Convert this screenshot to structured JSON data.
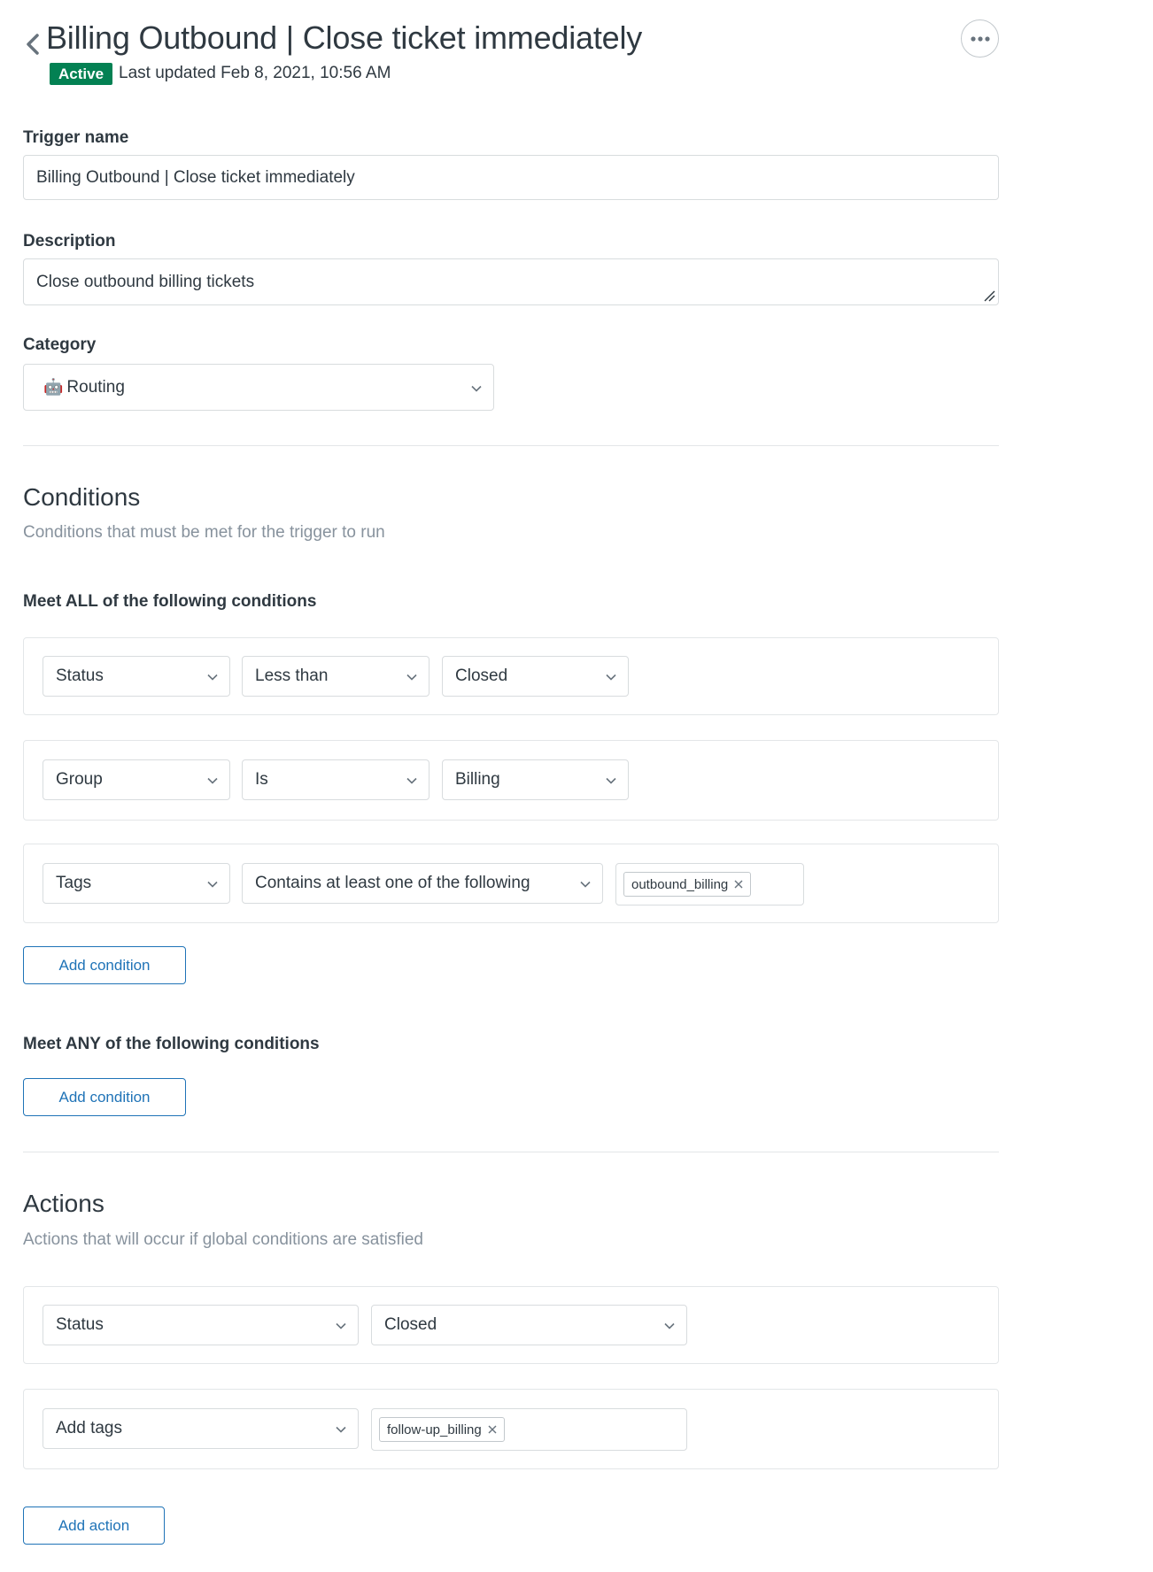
{
  "header": {
    "title": "Billing Outbound | Close ticket immediately",
    "status": "Active",
    "last_updated": "Last updated Feb 8, 2021, 10:56 AM"
  },
  "form": {
    "trigger_name": {
      "label": "Trigger name",
      "value": "Billing Outbound | Close ticket immediately"
    },
    "description": {
      "label": "Description",
      "value": "Close outbound billing tickets"
    },
    "category": {
      "label": "Category",
      "emoji": "🤖",
      "value": "Routing"
    }
  },
  "conditions": {
    "title": "Conditions",
    "description": "Conditions that must be met for the trigger to run",
    "all": {
      "label": "Meet ALL of the following conditions",
      "rows": [
        {
          "field": "Status",
          "operator": "Less than",
          "value": "Closed"
        },
        {
          "field": "Group",
          "operator": "Is",
          "value": "Billing"
        },
        {
          "field": "Tags",
          "operator": "Contains at least one of the following",
          "tag": "outbound_billing"
        }
      ],
      "add_label": "Add condition"
    },
    "any": {
      "label": "Meet ANY of the following conditions",
      "add_label": "Add condition"
    }
  },
  "actions": {
    "title": "Actions",
    "description": "Actions that will occur if global conditions are satisfied",
    "rows": [
      {
        "field": "Status",
        "value": "Closed"
      },
      {
        "field": "Add tags",
        "tag": "follow-up_billing"
      }
    ],
    "add_label": "Add action"
  },
  "colors": {
    "active_badge": "#038153",
    "primary": "#1f73b7",
    "text": "#2f3941",
    "muted": "#87929d",
    "border": "#d8dcde"
  }
}
